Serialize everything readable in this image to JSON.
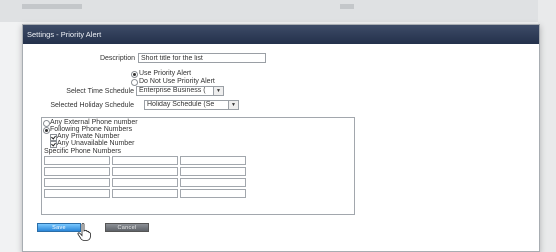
{
  "dialog": {
    "title": "Settings - Priority Alert"
  },
  "form": {
    "description_label": "Description",
    "description_value": "Short title for the list",
    "radio_use": "Use Priority Alert",
    "radio_do_not_use": "Do Not Use Priority Alert",
    "time_schedule_label": "Select Time Schedule",
    "time_schedule_value": "Enterprise Business (",
    "holiday_schedule_label": "Selected Holiday Schedule",
    "holiday_schedule_value": "Holiday Schedule (Se"
  },
  "phones": {
    "any_external": "Any External Phone number",
    "following": "Following Phone Numbers",
    "any_private": "Any Private Number",
    "any_unavailable": "Any Unavailable Number",
    "specific_label": "Specific Phone Numbers"
  },
  "buttons": {
    "save": "Save",
    "cancel": "Cancel"
  },
  "colors": {
    "titlebar": "#2f3c58",
    "save": "#2a86d8",
    "cancel": "#6b6f75"
  }
}
